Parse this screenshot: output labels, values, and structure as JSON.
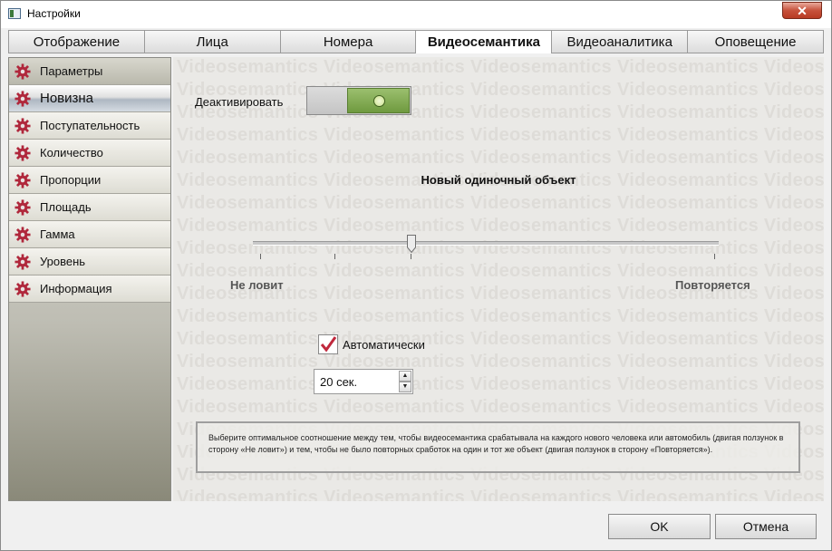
{
  "window": {
    "title": "Настройки",
    "close_glyph": "✕"
  },
  "tabs": [
    {
      "label": "Отображение"
    },
    {
      "label": "Лица"
    },
    {
      "label": "Номера"
    },
    {
      "label": "Видеосемантика",
      "active": true
    },
    {
      "label": "Видеоаналитика"
    },
    {
      "label": "Оповещение"
    }
  ],
  "sidebar": {
    "items": [
      {
        "label": "Параметры",
        "icon": "gear-icon"
      },
      {
        "label": "Новизна",
        "icon": "gear-icon",
        "selected": true
      },
      {
        "label": "Поступательность",
        "icon": "gear-icon"
      },
      {
        "label": "Количество",
        "icon": "gear-icon"
      },
      {
        "label": "Пропорции",
        "icon": "gear-icon"
      },
      {
        "label": "Площадь",
        "icon": "gear-icon"
      },
      {
        "label": "Гамма",
        "icon": "gear-icon"
      },
      {
        "label": "Уровень",
        "icon": "gear-icon"
      },
      {
        "label": "Информация",
        "icon": "gear-icon"
      }
    ]
  },
  "main": {
    "watermark": "Videosemantics Videosemantics Videosemantics Videosemantics Videosemantics",
    "deactivate": {
      "label": "Деактивировать",
      "state": "on"
    },
    "slider": {
      "title": "Новый одиночный объект",
      "min_label": "Не ловит",
      "max_label": "Повторяется",
      "value_fraction": 0.34
    },
    "auto": {
      "label": "Автоматически",
      "checked": true
    },
    "interval": {
      "value": "20 сек."
    },
    "description": "Выберите оптимальное соотношение между тем, чтобы видеосемантика срабатывала на каждого нового человека или автомобиль (двигая ползунок в сторону «Не ловит») и тем, чтобы не было повторных сработок на один и тот же объект (двигая ползунок в сторону «Повторяется»)."
  },
  "footer": {
    "ok_label": "OK",
    "cancel_label": "Отмена"
  },
  "colors": {
    "accent_green": "#7aa648",
    "gear_red": "#b0283c",
    "checkmark": "#c0283c"
  }
}
